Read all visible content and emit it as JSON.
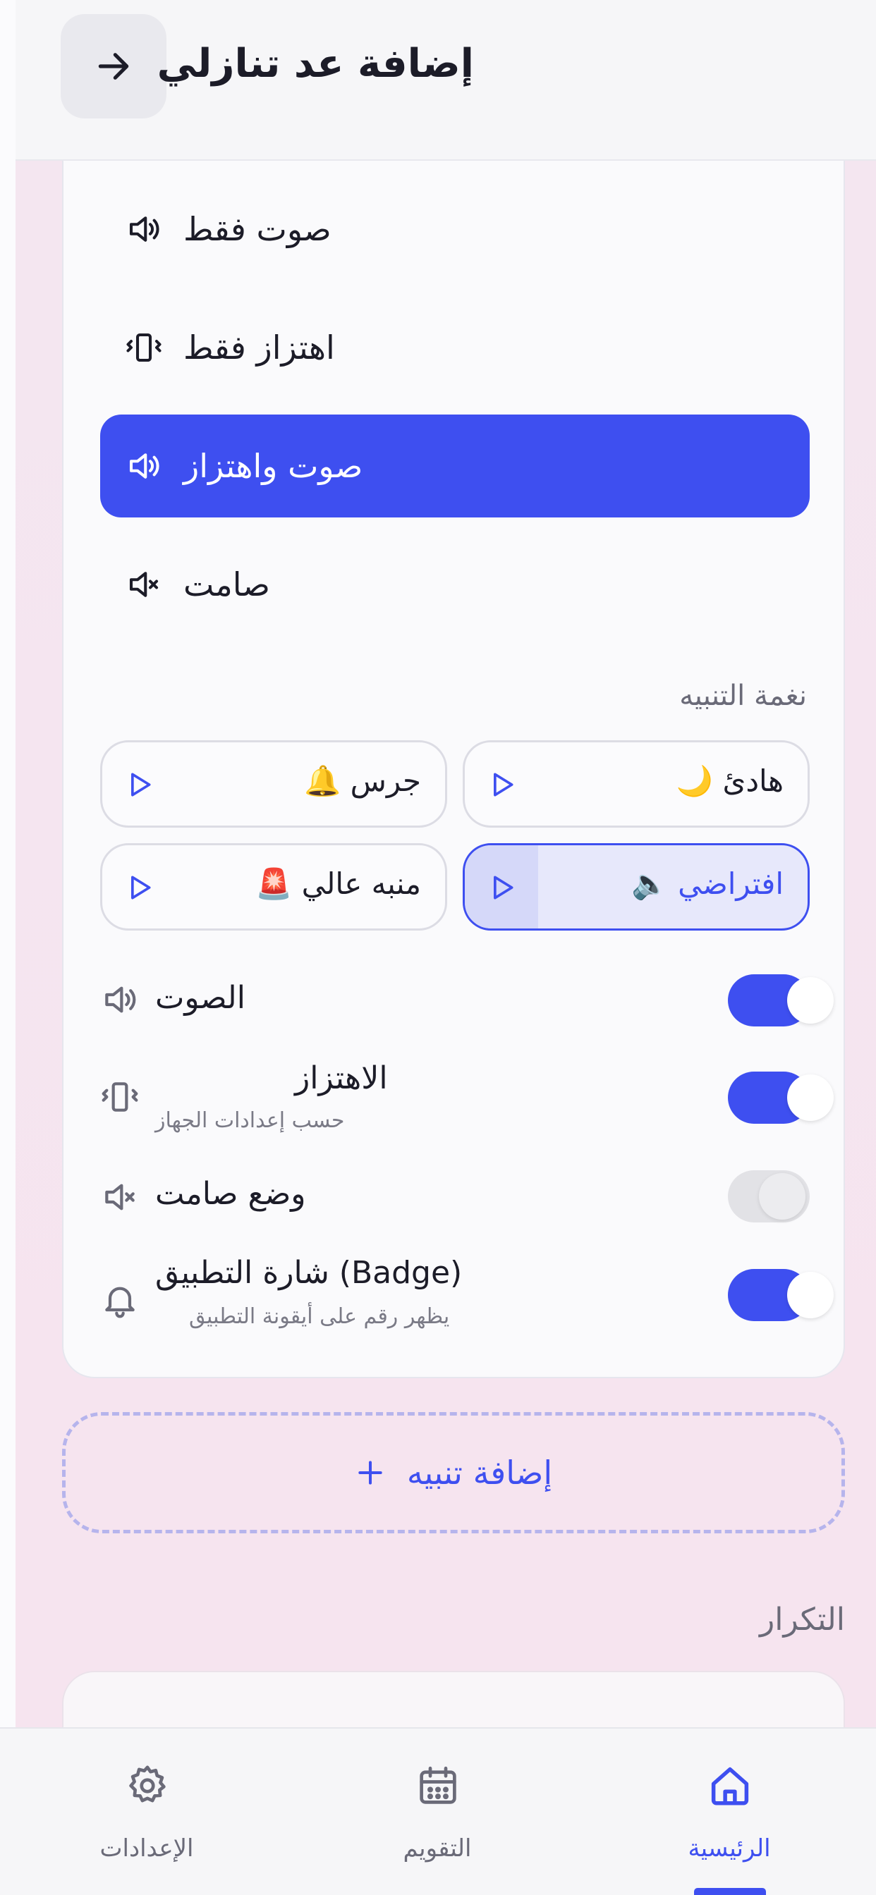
{
  "header": {
    "title": "إضافة عد تنازلي",
    "back_icon": "arrow-right-icon"
  },
  "alert_modes": [
    {
      "label": "صوت فقط",
      "icon": "speaker-icon",
      "active": false
    },
    {
      "label": "اهتزاز فقط",
      "icon": "vibrate-icon",
      "active": false
    },
    {
      "label": "صوت واهتزاز",
      "icon": "speaker-icon",
      "active": true
    },
    {
      "label": "صامت",
      "icon": "mute-icon",
      "active": false
    }
  ],
  "tone_section_label": "نغمة التنبيه",
  "tones": [
    {
      "label": "هادئ",
      "emoji": "🌙",
      "selected": false
    },
    {
      "label": "جرس",
      "emoji": "🔔",
      "selected": false
    },
    {
      "label": "افتراضي",
      "emoji": "🔈",
      "selected": true
    },
    {
      "label": "منبه عالي",
      "emoji": "🚨",
      "selected": false
    }
  ],
  "settings": [
    {
      "label": "الصوت",
      "sub": "",
      "icon": "speaker-icon",
      "enabled": true
    },
    {
      "label": "الاهتزاز",
      "sub": "حسب إعدادات الجهاز",
      "icon": "vibrate-icon",
      "enabled": true
    },
    {
      "label": "وضع صامت",
      "sub": "",
      "icon": "mute-icon",
      "enabled": false
    },
    {
      "label": "شارة التطبيق (Badge)",
      "sub": "يظهر رقم على أيقونة التطبيق",
      "icon": "bell-icon",
      "enabled": true
    }
  ],
  "add_alert": {
    "label": "إضافة تنبيه",
    "icon": "plus-icon"
  },
  "repeat_section_label": "التكرار",
  "nav": [
    {
      "label": "الإعدادات",
      "icon": "gear-icon",
      "active": false
    },
    {
      "label": "التقويم",
      "icon": "calendar-icon",
      "active": false
    },
    {
      "label": "الرئيسية",
      "icon": "home-icon",
      "active": true
    }
  ],
  "colors": {
    "accent": "#3e4ff0",
    "background": "#f5e4ef",
    "card": "#fafafc"
  }
}
